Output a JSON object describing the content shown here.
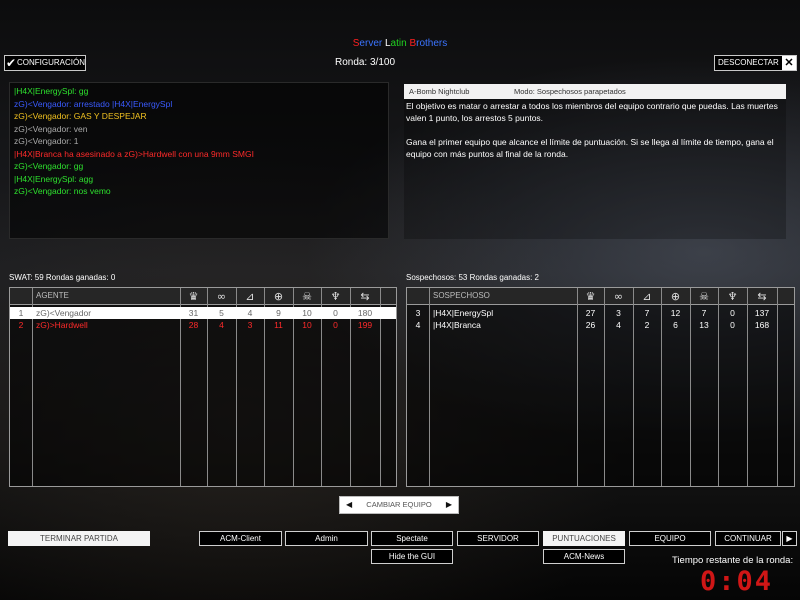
{
  "server": {
    "parts": [
      {
        "text": "S",
        "color": "#ff2020"
      },
      {
        "text": "erver ",
        "color": "#3b74ff"
      },
      {
        "text": "L",
        "color": "#ffffff"
      },
      {
        "text": "atin ",
        "color": "#20d020"
      },
      {
        "text": "B",
        "color": "#ff2020"
      },
      {
        "text": "rothers",
        "color": "#3b74ff"
      }
    ]
  },
  "round_label": "Ronda: 3/100",
  "buttons": {
    "config": "CONFIGURACIÓN",
    "disconnect": "DESCONECTAR",
    "change_team": "CAMBIAR EQUIPO",
    "end_game": "TERMINAR PARTIDA",
    "acm_client": "ACM-Client",
    "admin": "Admin",
    "spectate": "Spectate",
    "hide_gui": "Hide the GUI",
    "server": "SERVIDOR",
    "scores": "PUNTUACIONES",
    "acm_news": "ACM-News",
    "team": "EQUIPO",
    "continue": "CONTINUAR"
  },
  "chat": [
    {
      "text": "|H4X|EnergySpl:  gg",
      "color": "#2ee02e"
    },
    {
      "text": " zG)<Vengador: arrestado |H4X|EnergySpl",
      "color": "#3a5bff"
    },
    {
      "text": "zG)<Vengador:  GAS Y DESPEJAR",
      "color": "#f0c020"
    },
    {
      "text": "zG)<Vengador:  ven",
      "color": "#a9a9a9"
    },
    {
      "text": "zG)<Vengador:  1",
      "color": "#a9a9a9"
    },
    {
      "text": " |H4X|Branca ha asesinado a zG)>Hardwell con una 9mm SMGI",
      "color": "#ff2a2a"
    },
    {
      "text": "zG)<Vengador:  gg",
      "color": "#2ee02e"
    },
    {
      "text": "|H4X|EnergySpl:  agg",
      "color": "#2ee02e"
    },
    {
      "text": "zG)<Vengador:  nos vemo",
      "color": "#2ee02e"
    }
  ],
  "info": {
    "map": "A-Bomb Nightclub",
    "mode": "Modo: Sospechosos parapetados",
    "paragraph1": "El objetivo es matar o arrestar a todos los miembros del equipo contrario que puedas. Las muertes valen 1 punto, los arrestos 5 puntos.",
    "paragraph2": "Gana el primer equipo que alcance el límite de puntuación. Si se llega al límite de tiempo, gana el equipo con más puntos al final de la ronda."
  },
  "swat": {
    "label": "SWAT: 59 Rondas ganadas: 0",
    "header": "AGENTE",
    "rows": [
      {
        "num": "1",
        "name": "zG)<Vengador",
        "v": [
          "31",
          "5",
          "4",
          "9",
          "10",
          "0",
          "180"
        ],
        "selected": true,
        "color": "#666666"
      },
      {
        "num": "2",
        "name": "zG)>Hardwell",
        "v": [
          "28",
          "4",
          "3",
          "11",
          "10",
          "0",
          "199"
        ],
        "selected": false,
        "color": "#ff2a2a"
      }
    ]
  },
  "suspects": {
    "label": "Sospechosos: 53 Rondas ganadas: 2",
    "header": "SOSPECHOSO",
    "rows": [
      {
        "num": "3",
        "name": "|H4X|EnergySpl",
        "v": [
          "27",
          "3",
          "7",
          "12",
          "7",
          "0",
          "137"
        ],
        "selected": false,
        "color": "#ffffff"
      },
      {
        "num": "4",
        "name": "|H4X|Branca",
        "v": [
          "26",
          "4",
          "2",
          "6",
          "13",
          "0",
          "168"
        ],
        "selected": false,
        "color": "#ffffff"
      }
    ]
  },
  "column_icons": [
    "trophy-icon",
    "handcuffs-icon",
    "rifle-icon",
    "crosshair-icon",
    "skull-icon",
    "medal-icon",
    "ping-icon"
  ],
  "time": {
    "label": "Tiempo restante de la ronda:",
    "value": "0:04"
  }
}
